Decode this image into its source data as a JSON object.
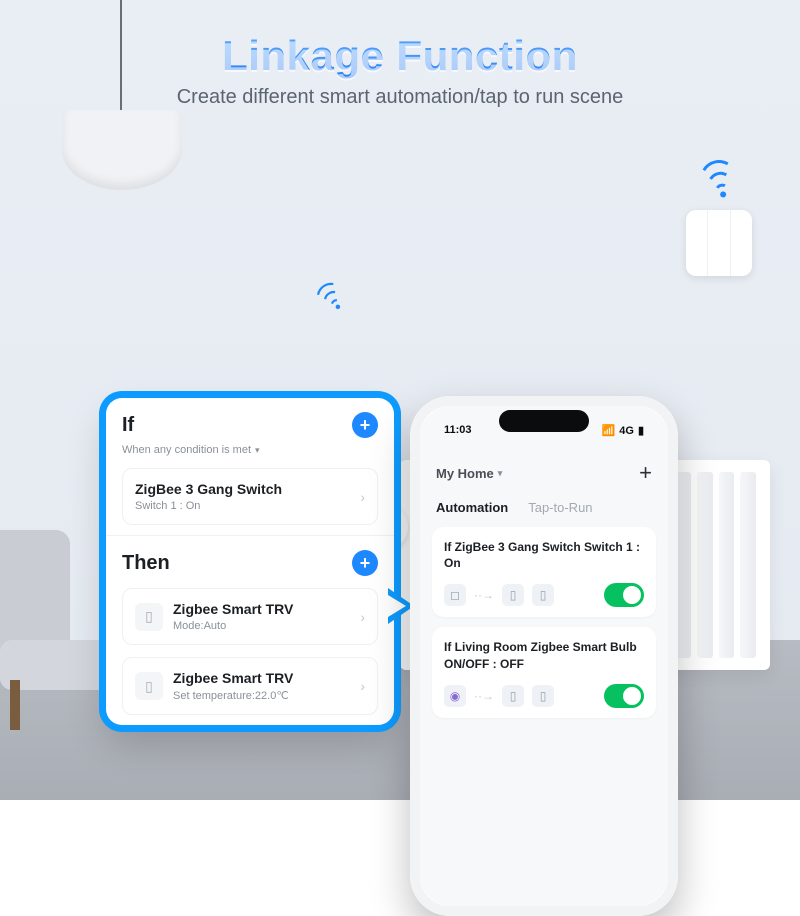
{
  "hero": {
    "title": "Linkage Function",
    "subtitle": "Create different smart automation/tap to run scene"
  },
  "popup": {
    "if": {
      "label": "If",
      "condition": "When any condition is met",
      "item": {
        "title": "ZigBee 3 Gang Switch",
        "sub": "Switch 1 : On"
      }
    },
    "then": {
      "label": "Then",
      "items": [
        {
          "title": "Zigbee Smart TRV",
          "sub": "Mode:Auto"
        },
        {
          "title": "Zigbee Smart TRV",
          "sub": "Set temperature:22.0℃"
        }
      ]
    }
  },
  "phone": {
    "status": {
      "time": "11:03",
      "net": "4G"
    },
    "home_label": "My Home",
    "tabs": {
      "automation": "Automation",
      "tap": "Tap-to-Run"
    },
    "cards": [
      {
        "title": "If ZigBee 3 Gang Switch Switch 1 : On"
      },
      {
        "title": "If  Living Room Zigbee Smart Bulb ON/OFF : OFF"
      }
    ]
  }
}
